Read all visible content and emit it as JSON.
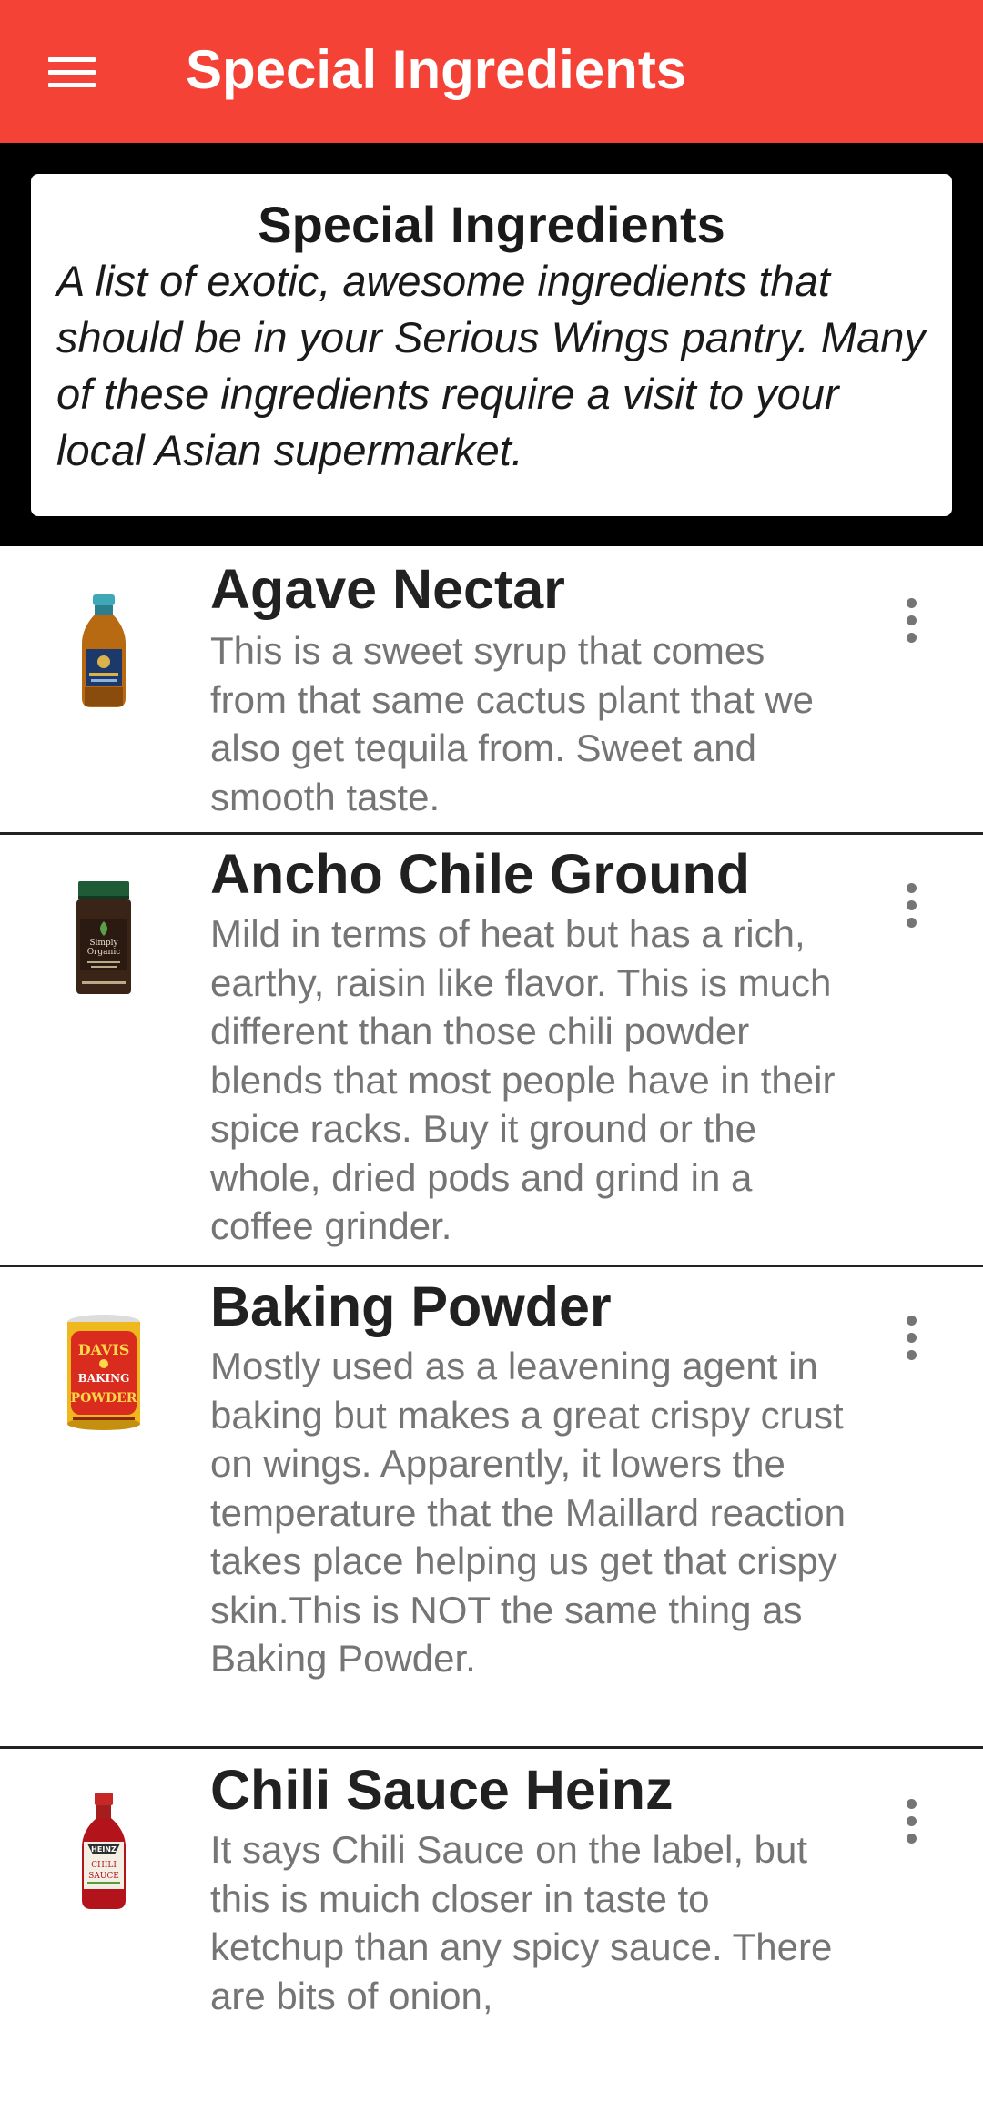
{
  "appbar": {
    "title": "Special Ingredients",
    "menu_icon": "hamburger-menu-icon",
    "color": "#f44336"
  },
  "banner": {
    "title": "Special Ingredients",
    "description": "A list of exotic, awesome ingredients that should be in your Serious Wings pantry. Many of these ingredients require a visit to your local Asian supermarket."
  },
  "ingredients": [
    {
      "name": "Agave Nectar",
      "description": "This is a sweet syrup that comes from that same cactus plant that we also get tequila from. Sweet and smooth taste.",
      "thumbnail": "agave-nectar-bottle",
      "more_icon": "more-vert-icon"
    },
    {
      "name": "Ancho Chile Ground",
      "description": "Mild in terms of heat but has a rich, earthy, raisin like flavor. This is much different than those chili powder blends that most people have in their spice racks. Buy it ground or the whole, dried pods and grind in a coffee grinder.",
      "thumbnail": "ancho-chile-jar",
      "more_icon": "more-vert-icon"
    },
    {
      "name": "Baking Powder",
      "description": "Mostly used as a leavening agent in baking but makes a great crispy crust on wings. Apparently, it lowers the temperature that the Maillard reaction takes place helping us get that crispy skin.This is NOT the same thing as Baking Powder.",
      "thumbnail": "baking-powder-can",
      "more_icon": "more-vert-icon"
    },
    {
      "name": "Chili Sauce Heinz",
      "description": "It says Chili Sauce on the label, but this is muich closer in taste to ketchup than any spicy sauce. There are bits of onion,",
      "thumbnail": "chili-sauce-bottle",
      "more_icon": "more-vert-icon"
    }
  ]
}
